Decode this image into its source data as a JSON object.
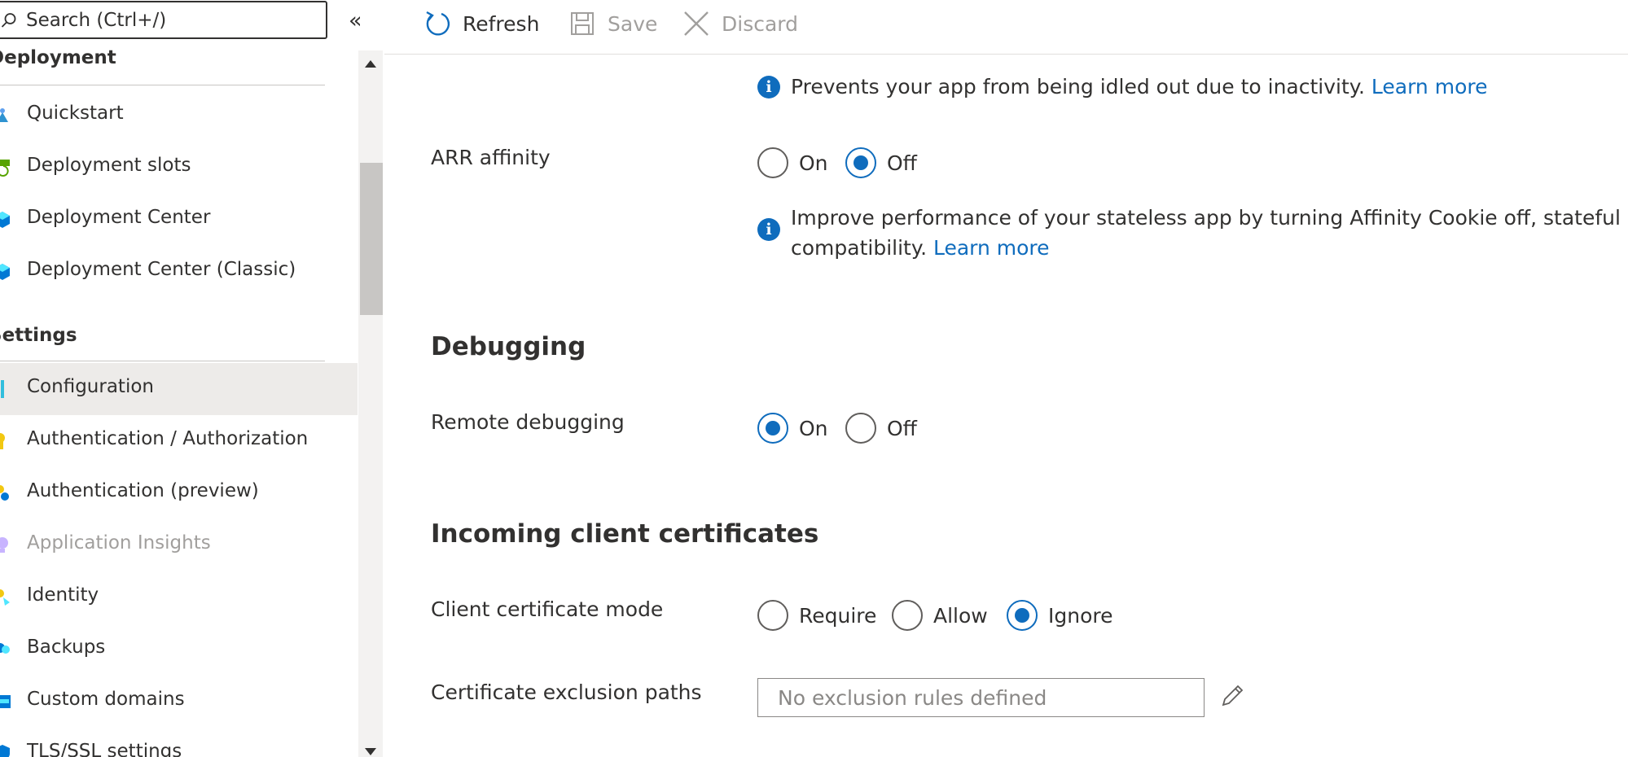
{
  "search": {
    "placeholder": "Search (Ctrl+/)"
  },
  "sidebar": {
    "collapse_glyph": "«",
    "sections": [
      {
        "title": "Deployment"
      },
      {
        "title": "Settings"
      }
    ],
    "items": [
      {
        "label": "Quickstart",
        "icon": "quickstart-icon",
        "color": "#2f93d1"
      },
      {
        "label": "Deployment slots",
        "icon": "deployment-slots-icon",
        "color": "#57a300"
      },
      {
        "label": "Deployment Center",
        "icon": "deployment-center-icon",
        "color": "#0078d4"
      },
      {
        "label": "Deployment Center (Classic)",
        "icon": "deployment-center-classic-icon",
        "color": "#0078d4"
      },
      {
        "label": "Configuration",
        "icon": "configuration-icon",
        "color": "#32bedd",
        "selected": true
      },
      {
        "label": "Authentication / Authorization",
        "icon": "auth-icon",
        "color": "#f2c811"
      },
      {
        "label": "Authentication (preview)",
        "icon": "auth-preview-icon",
        "color": "#f2c811"
      },
      {
        "label": "Application Insights",
        "icon": "app-insights-icon",
        "color": "#b4a0ff",
        "disabled": true
      },
      {
        "label": "Identity",
        "icon": "identity-icon",
        "color": "#f2c811"
      },
      {
        "label": "Backups",
        "icon": "backups-icon",
        "color": "#0078d4"
      },
      {
        "label": "Custom domains",
        "icon": "custom-domains-icon",
        "color": "#0078d4"
      },
      {
        "label": "TLS/SSL settings",
        "icon": "tls-ssl-icon",
        "color": "#0078d4"
      }
    ]
  },
  "toolbar": {
    "refresh_label": "Refresh",
    "save_label": "Save",
    "discard_label": "Discard"
  },
  "content": {
    "always_on_info": {
      "text": "Prevents your app from being idled out due to inactivity. ",
      "link": "Learn more"
    },
    "arr_affinity": {
      "label": "ARR affinity",
      "options": [
        "On",
        "Off"
      ],
      "selected": "Off",
      "info_line1": "Improve performance of your stateless app by turning Affinity Cookie off, stateful ap",
      "info_line2": "compatibility. ",
      "info_link": "Learn more"
    },
    "debugging": {
      "title": "Debugging",
      "remote_label": "Remote debugging",
      "options": [
        "On",
        "Off"
      ],
      "selected": "On"
    },
    "certificates": {
      "title": "Incoming client certificates",
      "mode_label": "Client certificate mode",
      "options": [
        "Require",
        "Allow",
        "Ignore"
      ],
      "selected": "Ignore",
      "exclusion_label": "Certificate exclusion paths",
      "exclusion_placeholder": "No exclusion rules defined"
    }
  },
  "colors": {
    "accent": "#0f6cbd",
    "text": "#323130",
    "disabled": "#a19f9d",
    "selected_bg": "#edebe9"
  }
}
